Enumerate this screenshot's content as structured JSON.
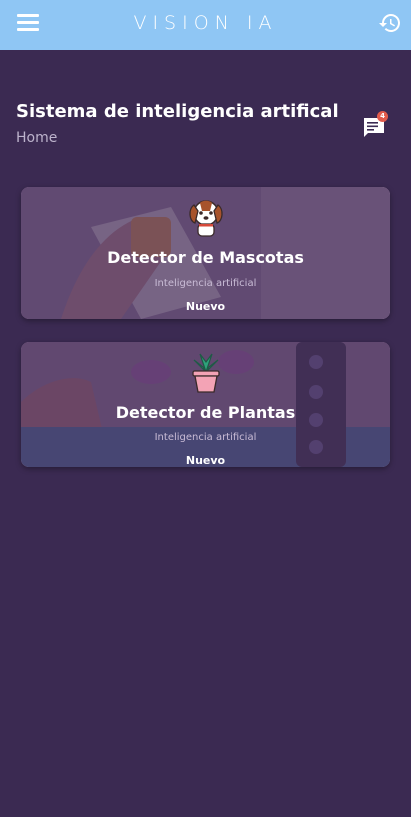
{
  "header": {
    "brand": "VISION IA",
    "menu_icon": "hamburger-menu-icon",
    "history_icon": "history-icon",
    "bar_color": "#8fc6f4"
  },
  "page": {
    "title": "Sistema de inteligencia artifical",
    "breadcrumb": "Home",
    "notification_count": "4",
    "chat_icon": "chat-notification-icon",
    "background_color": "#3b2a52"
  },
  "cards": [
    {
      "icon": "dog-icon",
      "title": "Detector de Mascotas",
      "subtitle": "Inteligencia artificial",
      "badge": "Nuevo"
    },
    {
      "icon": "potted-plant-icon",
      "title": "Detector de Plantas",
      "subtitle": "Inteligencia artificial",
      "badge": "Nuevo"
    }
  ]
}
